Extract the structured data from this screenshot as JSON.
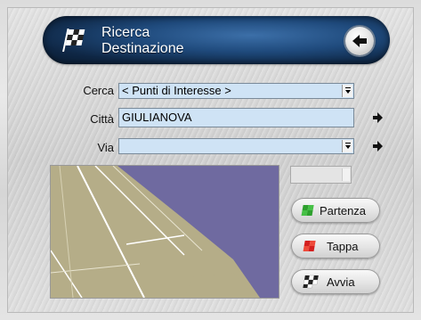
{
  "header": {
    "title_line1": "Ricerca",
    "title_line2": "Destinazione"
  },
  "form": {
    "cerca": {
      "label": "Cerca",
      "value": "< Punti di Interesse >"
    },
    "citta": {
      "label": "Città",
      "value": "GIULIANOVA"
    },
    "via": {
      "label": "Via",
      "value": ""
    }
  },
  "buttons": {
    "partenza": "Partenza",
    "tappa": "Tappa",
    "avvia": "Avvia"
  },
  "colors": {
    "field_bg": "#cfe3f5",
    "map_water": "#6f6aa0",
    "map_land": "#b5ad88",
    "header_blue": "#1f4a7c"
  },
  "icons": [
    "checkered-flag-icon",
    "back-arrow-icon",
    "arrow-right-icon",
    "dropdown-arrow-icon",
    "green-flag-icon",
    "red-flag-icon"
  ]
}
